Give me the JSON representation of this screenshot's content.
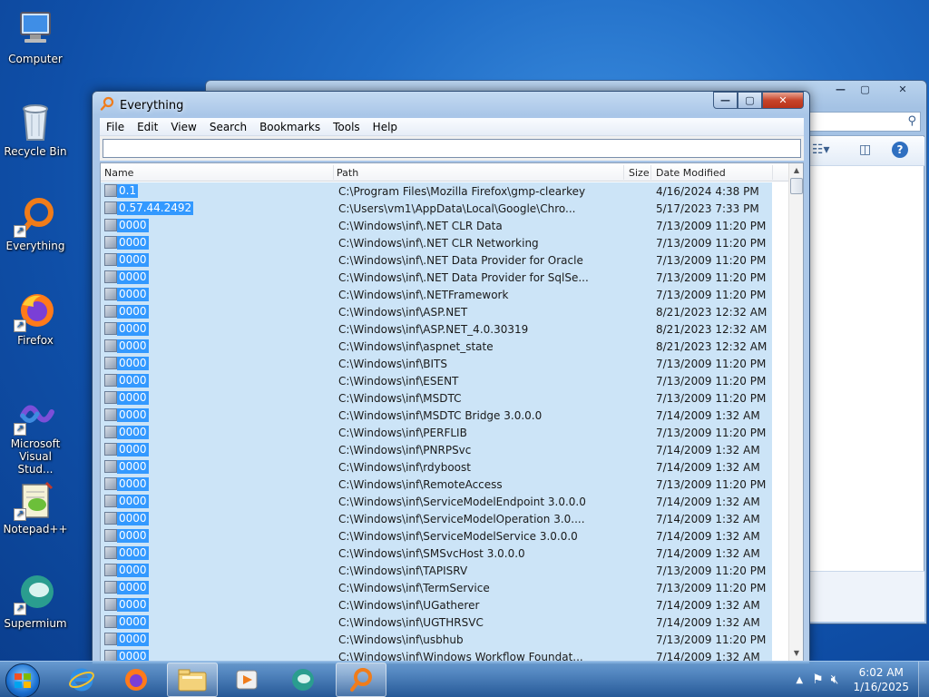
{
  "desktop": {
    "icons": [
      {
        "label": "Computer",
        "icon": "computer-icon"
      },
      {
        "label": "Recycle Bin",
        "icon": "recycle-bin-icon"
      },
      {
        "label": "Everything",
        "icon": "everything-icon"
      },
      {
        "label": "Firefox",
        "icon": "firefox-icon"
      },
      {
        "label": "Microsoft Visual Stud...",
        "icon": "visual-studio-icon"
      },
      {
        "label": "Notepad++",
        "icon": "notepadpp-icon"
      },
      {
        "label": "Supermium",
        "icon": "supermium-icon"
      }
    ]
  },
  "window": {
    "title": "Everything",
    "menu": [
      "File",
      "Edit",
      "View",
      "Search",
      "Bookmarks",
      "Tools",
      "Help"
    ],
    "search_value": "",
    "columns": {
      "name": "Name",
      "path": "Path",
      "size": "Size",
      "date": "Date Modified"
    },
    "rows": [
      {
        "name": "0.1",
        "path": "C:\\Program Files\\Mozilla Firefox\\gmp-clearkey",
        "date": "4/16/2024 4:38 PM"
      },
      {
        "name": "0.57.44.2492",
        "path": "C:\\Users\\vm1\\AppData\\Local\\Google\\Chro...",
        "date": "5/17/2023 7:33 PM"
      },
      {
        "name": "0000",
        "path": "C:\\Windows\\inf\\.NET CLR Data",
        "date": "7/13/2009 11:20 PM"
      },
      {
        "name": "0000",
        "path": "C:\\Windows\\inf\\.NET CLR Networking",
        "date": "7/13/2009 11:20 PM"
      },
      {
        "name": "0000",
        "path": "C:\\Windows\\inf\\.NET Data Provider for Oracle",
        "date": "7/13/2009 11:20 PM"
      },
      {
        "name": "0000",
        "path": "C:\\Windows\\inf\\.NET Data Provider for SqlSe...",
        "date": "7/13/2009 11:20 PM"
      },
      {
        "name": "0000",
        "path": "C:\\Windows\\inf\\.NETFramework",
        "date": "7/13/2009 11:20 PM"
      },
      {
        "name": "0000",
        "path": "C:\\Windows\\inf\\ASP.NET",
        "date": "8/21/2023 12:32 AM"
      },
      {
        "name": "0000",
        "path": "C:\\Windows\\inf\\ASP.NET_4.0.30319",
        "date": "8/21/2023 12:32 AM"
      },
      {
        "name": "0000",
        "path": "C:\\Windows\\inf\\aspnet_state",
        "date": "8/21/2023 12:32 AM"
      },
      {
        "name": "0000",
        "path": "C:\\Windows\\inf\\BITS",
        "date": "7/13/2009 11:20 PM"
      },
      {
        "name": "0000",
        "path": "C:\\Windows\\inf\\ESENT",
        "date": "7/13/2009 11:20 PM"
      },
      {
        "name": "0000",
        "path": "C:\\Windows\\inf\\MSDTC",
        "date": "7/13/2009 11:20 PM"
      },
      {
        "name": "0000",
        "path": "C:\\Windows\\inf\\MSDTC Bridge 3.0.0.0",
        "date": "7/14/2009 1:32 AM"
      },
      {
        "name": "0000",
        "path": "C:\\Windows\\inf\\PERFLIB",
        "date": "7/13/2009 11:20 PM"
      },
      {
        "name": "0000",
        "path": "C:\\Windows\\inf\\PNRPSvc",
        "date": "7/14/2009 1:32 AM"
      },
      {
        "name": "0000",
        "path": "C:\\Windows\\inf\\rdyboost",
        "date": "7/14/2009 1:32 AM"
      },
      {
        "name": "0000",
        "path": "C:\\Windows\\inf\\RemoteAccess",
        "date": "7/13/2009 11:20 PM"
      },
      {
        "name": "0000",
        "path": "C:\\Windows\\inf\\ServiceModelEndpoint 3.0.0.0",
        "date": "7/14/2009 1:32 AM"
      },
      {
        "name": "0000",
        "path": "C:\\Windows\\inf\\ServiceModelOperation 3.0....",
        "date": "7/14/2009 1:32 AM"
      },
      {
        "name": "0000",
        "path": "C:\\Windows\\inf\\ServiceModelService 3.0.0.0",
        "date": "7/14/2009 1:32 AM"
      },
      {
        "name": "0000",
        "path": "C:\\Windows\\inf\\SMSvcHost 3.0.0.0",
        "date": "7/14/2009 1:32 AM"
      },
      {
        "name": "0000",
        "path": "C:\\Windows\\inf\\TAPISRV",
        "date": "7/13/2009 11:20 PM"
      },
      {
        "name": "0000",
        "path": "C:\\Windows\\inf\\TermService",
        "date": "7/13/2009 11:20 PM"
      },
      {
        "name": "0000",
        "path": "C:\\Windows\\inf\\UGatherer",
        "date": "7/14/2009 1:32 AM"
      },
      {
        "name": "0000",
        "path": "C:\\Windows\\inf\\UGTHRSVC",
        "date": "7/14/2009 1:32 AM"
      },
      {
        "name": "0000",
        "path": "C:\\Windows\\inf\\usbhub",
        "date": "7/13/2009 11:20 PM"
      },
      {
        "name": "0000",
        "path": "C:\\Windows\\inf\\Windows Workflow Foundat...",
        "date": "7/14/2009 1:32 AM"
      }
    ]
  },
  "taskbar": {
    "items": [
      "start-orb",
      "internet-explorer-icon",
      "firefox-icon",
      "windows-explorer-icon",
      "media-player-icon",
      "supermium-icon",
      "everything-icon"
    ],
    "clock_time": "6:02 AM",
    "clock_date": "1/16/2025"
  },
  "colors": {
    "selection": "#cce4f7",
    "name_highlight": "#3399ff",
    "accent": "#1f6cc6"
  }
}
